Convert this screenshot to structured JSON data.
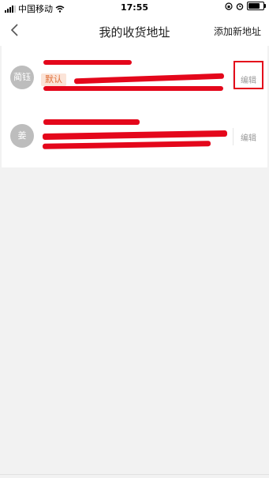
{
  "status_bar": {
    "carrier": "中国移动",
    "time": "17:55",
    "battery_level": 0.75
  },
  "nav": {
    "title": "我的收货地址",
    "action": "添加新地址"
  },
  "addresses": [
    {
      "avatar_text": "蔺钰",
      "tag": "默认",
      "edit_label": "编辑"
    },
    {
      "avatar_text": "姜",
      "edit_label": "编辑"
    }
  ],
  "colors": {
    "tag_bg": "#fbe4d8",
    "tag_text": "#e0703a",
    "avatar_bg": "#bdbdbd",
    "highlight_border": "#e4071b",
    "page_bg": "#f2f2f2"
  }
}
